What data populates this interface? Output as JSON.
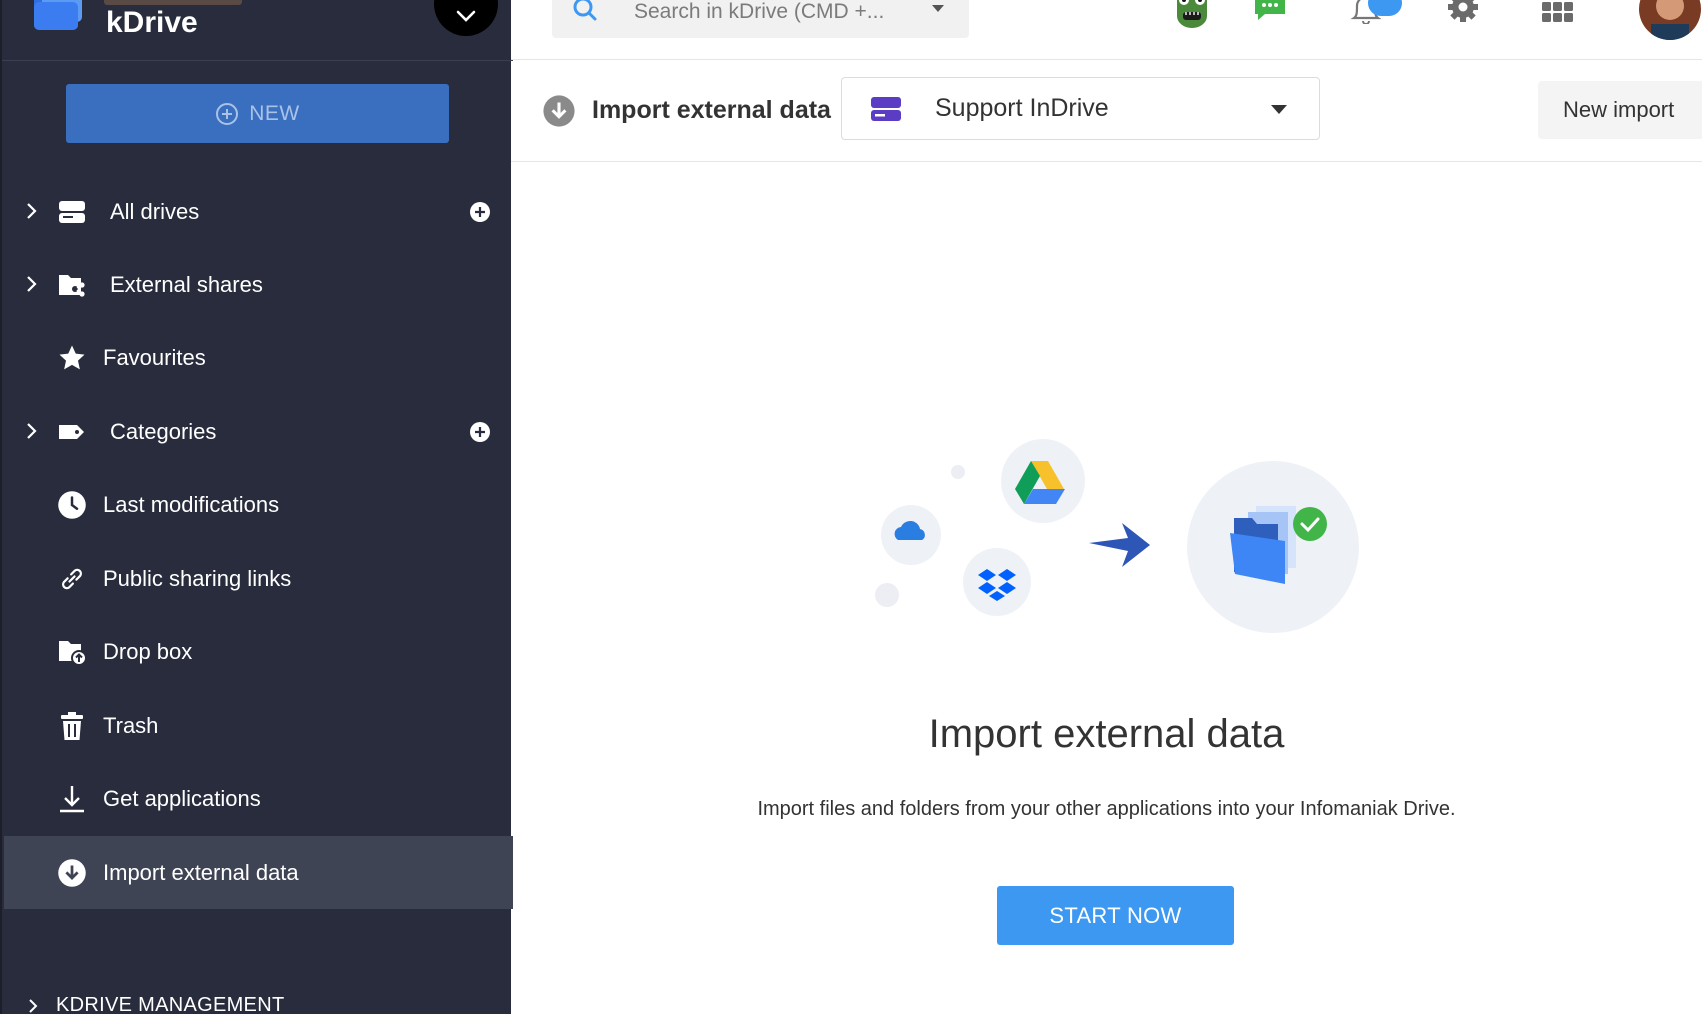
{
  "app": {
    "name": "kDrive"
  },
  "sidebar": {
    "new_label": "NEW",
    "items": [
      {
        "label": "All drives",
        "icon": "drive-icon",
        "expandable": true,
        "addable": true
      },
      {
        "label": "External shares",
        "icon": "shared-folder-icon",
        "expandable": true,
        "addable": false
      },
      {
        "label": "Favourites",
        "icon": "star-icon",
        "expandable": false,
        "addable": false
      },
      {
        "label": "Categories",
        "icon": "tag-icon",
        "expandable": true,
        "addable": true
      },
      {
        "label": "Last modifications",
        "icon": "clock-icon",
        "expandable": false,
        "addable": false
      },
      {
        "label": "Public sharing links",
        "icon": "link-icon",
        "expandable": false,
        "addable": false
      },
      {
        "label": "Drop box",
        "icon": "dropbox-folder-icon",
        "expandable": false,
        "addable": false
      },
      {
        "label": "Trash",
        "icon": "trash-icon",
        "expandable": false,
        "addable": false
      },
      {
        "label": "Get applications",
        "icon": "download-icon",
        "expandable": false,
        "addable": false
      },
      {
        "label": "Import external data",
        "icon": "import-icon",
        "expandable": false,
        "addable": false,
        "active": true
      }
    ],
    "management_label": "KDRIVE MANAGEMENT"
  },
  "topbar": {
    "search_placeholder": "Search in kDrive (CMD +...",
    "icons": [
      "search-icon",
      "monster-avatar-icon",
      "chat-icon",
      "notification-bell-icon",
      "settings-gear-icon",
      "apps-grid-icon",
      "user-avatar"
    ]
  },
  "toolbar": {
    "title": "Import external data",
    "drive_selected": "Support InDrive",
    "new_import_label": "New import"
  },
  "main": {
    "title": "Import external data",
    "description": "Import files and folders from your other applications into your Infomaniak Drive.",
    "start_label": "START NOW"
  },
  "colors": {
    "sidebar_bg": "#282c3c",
    "sidebar_active": "#3f4454",
    "new_button": "#3a6fc0",
    "start_button": "#3d98f2",
    "drive_icon": "#5b3cc4",
    "notification_badge": "#3d98f2"
  }
}
